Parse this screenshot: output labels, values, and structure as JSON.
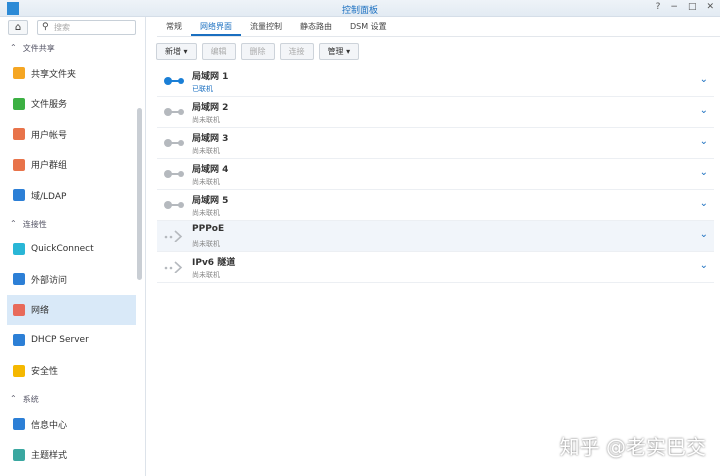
{
  "window": {
    "title": "控制面板",
    "help": "?",
    "minimize": "−",
    "maximize": "□",
    "close": "✕"
  },
  "sidebar": {
    "search_placeholder": "搜索",
    "sections": [
      {
        "label": "文件共享",
        "items": [
          {
            "label": "共享文件夹",
            "color": "#f5a623"
          },
          {
            "label": "文件服务",
            "color": "#3cb043"
          },
          {
            "label": "用户帐号",
            "color": "#e8734a"
          },
          {
            "label": "用户群组",
            "color": "#e8734a"
          },
          {
            "label": "域/LDAP",
            "color": "#2c7fd6"
          }
        ]
      },
      {
        "label": "连接性",
        "items": [
          {
            "label": "QuickConnect",
            "color": "#29b6d6"
          },
          {
            "label": "外部访问",
            "color": "#2c7fd6"
          },
          {
            "label": "网络",
            "color": "#e86a5a"
          },
          {
            "label": "DHCP Server",
            "color": "#2c7fd6"
          },
          {
            "label": "安全性",
            "color": "#f5b800"
          }
        ]
      },
      {
        "label": "系统",
        "items": [
          {
            "label": "信息中心",
            "color": "#2c7fd6"
          },
          {
            "label": "主题样式",
            "color": "#3aa7a0"
          }
        ]
      }
    ]
  },
  "tabs": [
    "常规",
    "网络界面",
    "流量控制",
    "静态路由",
    "DSM 设置"
  ],
  "toolbar": {
    "add": "新增 ▾",
    "edit": "编辑",
    "delete": "删除",
    "connect": "连接",
    "manage": "管理 ▾"
  },
  "interfaces": [
    {
      "name": "局域网 1",
      "status": "已联机",
      "type": "lan",
      "connected": true
    },
    {
      "name": "局域网 2",
      "status": "尚未联机",
      "type": "lan"
    },
    {
      "name": "局域网 3",
      "status": "尚未联机",
      "type": "lan"
    },
    {
      "name": "局域网 4",
      "status": "尚未联机",
      "type": "lan"
    },
    {
      "name": "局域网 5",
      "status": "尚未联机",
      "type": "lan"
    },
    {
      "name": "PPPoE",
      "status": "尚未联机",
      "type": "tunnel"
    },
    {
      "name": "IPv6 隧道",
      "status": "尚未联机",
      "type": "tunnel"
    }
  ],
  "watermark": "知乎 @老实巴交"
}
